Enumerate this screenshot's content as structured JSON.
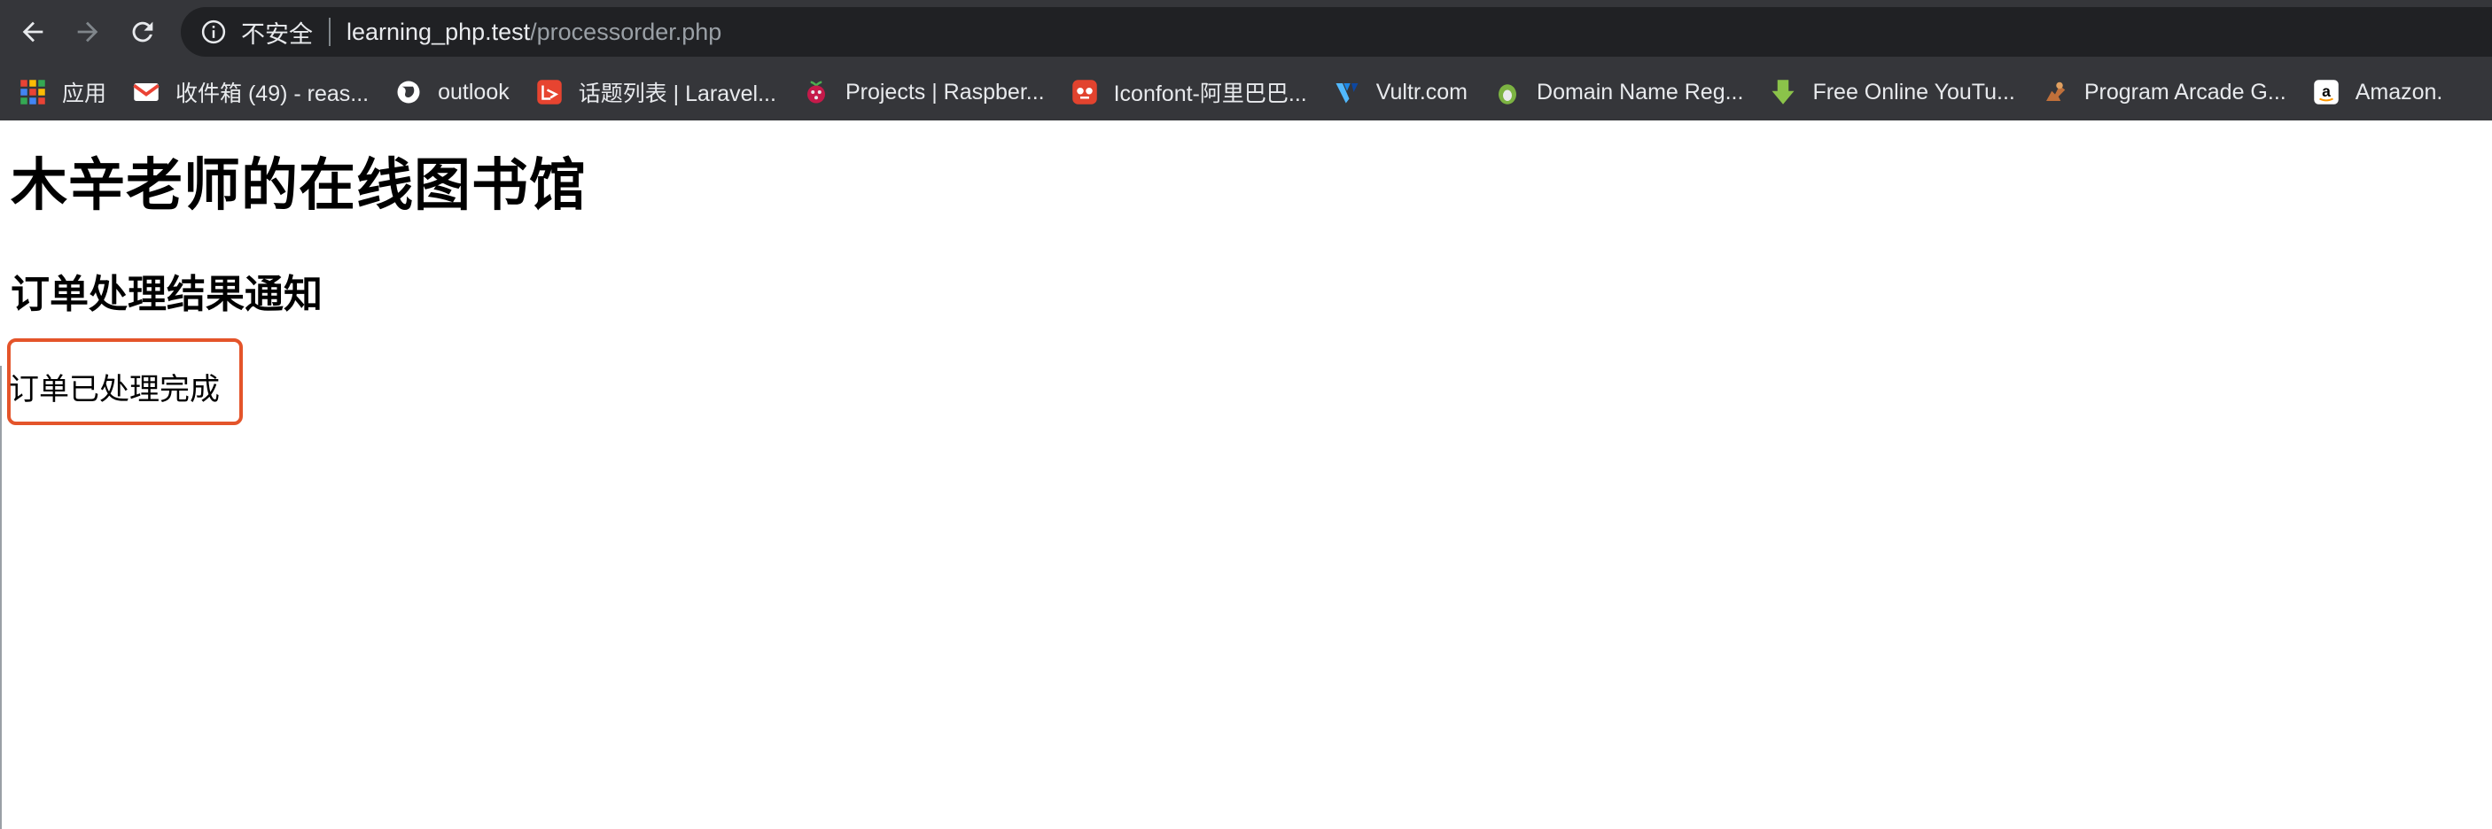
{
  "browser": {
    "insecure_label": "不安全",
    "url_host": "learning_php.test",
    "url_path": "/processorder.php"
  },
  "bookmarks": [
    {
      "label": "应用",
      "icon": "apps-grid-icon"
    },
    {
      "label": "收件箱 (49) - reas...",
      "icon": "gmail-icon"
    },
    {
      "label": "outlook",
      "icon": "globe-icon"
    },
    {
      "label": "话题列表 | Laravel...",
      "icon": "laravel-icon"
    },
    {
      "label": "Projects | Raspber...",
      "icon": "raspberry-icon"
    },
    {
      "label": "Iconfont-阿里巴巴...",
      "icon": "iconfont-icon"
    },
    {
      "label": "Vultr.com",
      "icon": "vultr-icon"
    },
    {
      "label": "Domain Name Reg...",
      "icon": "namecheap-icon"
    },
    {
      "label": "Free Online YouTu...",
      "icon": "download-arrow-icon"
    },
    {
      "label": "Program Arcade G...",
      "icon": "arcade-icon"
    },
    {
      "label": "Amazon.",
      "icon": "amazon-icon"
    }
  ],
  "page": {
    "title": "木辛老师的在线图书馆",
    "subtitle": "订单处理结果通知",
    "message": "订单已处理完成"
  },
  "colors": {
    "chrome_bg": "#35363a",
    "omnibox_bg": "#202124",
    "highlight_border": "#e4542a"
  }
}
